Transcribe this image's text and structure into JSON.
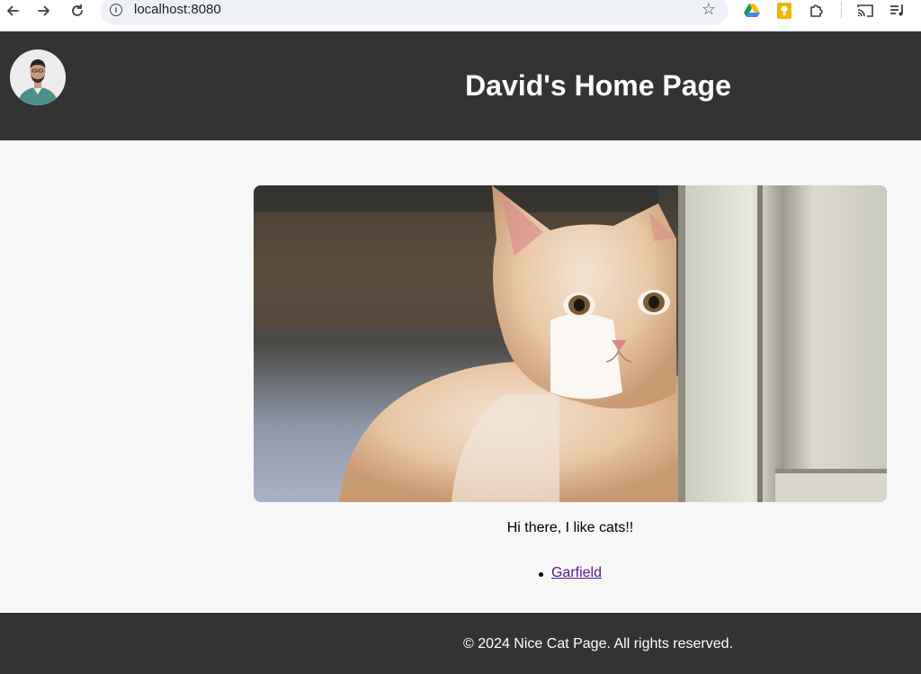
{
  "browser": {
    "url": "localhost:8080",
    "info_glyph": "i",
    "icons": [
      "back-arrow-icon",
      "forward-arrow-icon",
      "reload-icon",
      "site-info-icon",
      "bookmark-star-icon",
      "google-drive-icon",
      "keep-notes-icon",
      "extensions-puzzle-icon",
      "cast-icon",
      "media-queue-icon"
    ]
  },
  "header": {
    "title": "David's Home Page",
    "avatar": "profile-avatar",
    "background_color": "#333333"
  },
  "main": {
    "hero_image": "cat-photo",
    "tagline": "Hi there, I like cats!!",
    "links": [
      {
        "label": "Garfield",
        "visited": true
      }
    ],
    "link_color": "#551a8b"
  },
  "footer": {
    "text": "© 2024 Nice Cat Page. All rights reserved."
  }
}
